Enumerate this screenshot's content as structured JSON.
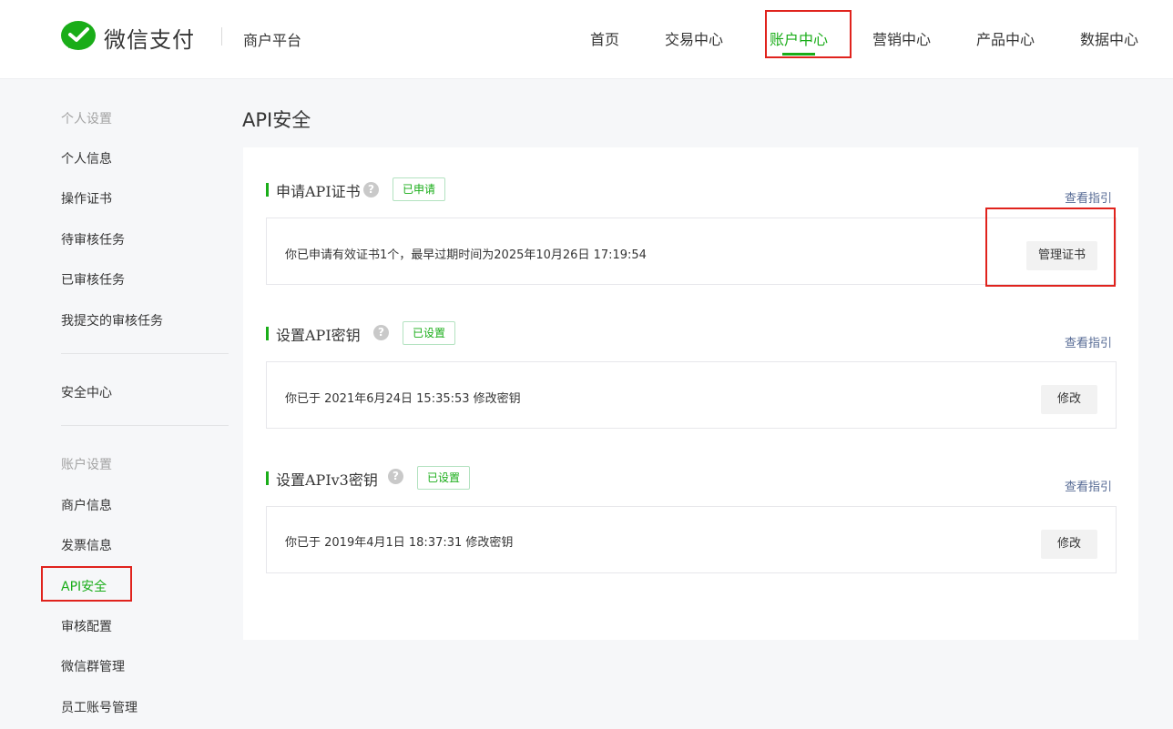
{
  "header": {
    "brand": "微信支付",
    "platform": "商户平台",
    "nav": [
      "首页",
      "交易中心",
      "账户中心",
      "营销中心",
      "产品中心",
      "数据中心"
    ],
    "active_nav": "账户中心"
  },
  "sidebar": {
    "group_personal": "个人设置",
    "personal_items": [
      "个人信息",
      "操作证书",
      "待审核任务",
      "已审核任务",
      "我提交的审核任务"
    ],
    "security_center": "安全中心",
    "group_account": "账户设置",
    "account_items": [
      "商户信息",
      "发票信息",
      "API安全",
      "审核配置",
      "微信群管理",
      "员工账号管理"
    ],
    "active_item": "API安全"
  },
  "main": {
    "title": "API安全",
    "sections": [
      {
        "title": "申请API证书",
        "status": "已申请",
        "guide": "查看指引",
        "text": "你已申请有效证书1个，最早过期时间为2025年10月26日 17:19:54",
        "button": "管理证书"
      },
      {
        "title": "设置API密钥",
        "status": "已设置",
        "guide": "查看指引",
        "text": "你已于 2021年6月24日 15:35:53 修改密钥",
        "button": "修改"
      },
      {
        "title": "设置APIv3密钥",
        "status": "已设置",
        "guide": "查看指引",
        "text": "你已于 2019年4月1日 18:37:31 修改密钥",
        "button": "修改"
      }
    ],
    "help_glyph": "?"
  },
  "colors": {
    "accent": "#1aad19",
    "highlight": "#e0231d",
    "link": "#576b95"
  },
  "icons": {
    "logo": "wechat-pay-logo-icon",
    "help": "question-mark-icon"
  }
}
